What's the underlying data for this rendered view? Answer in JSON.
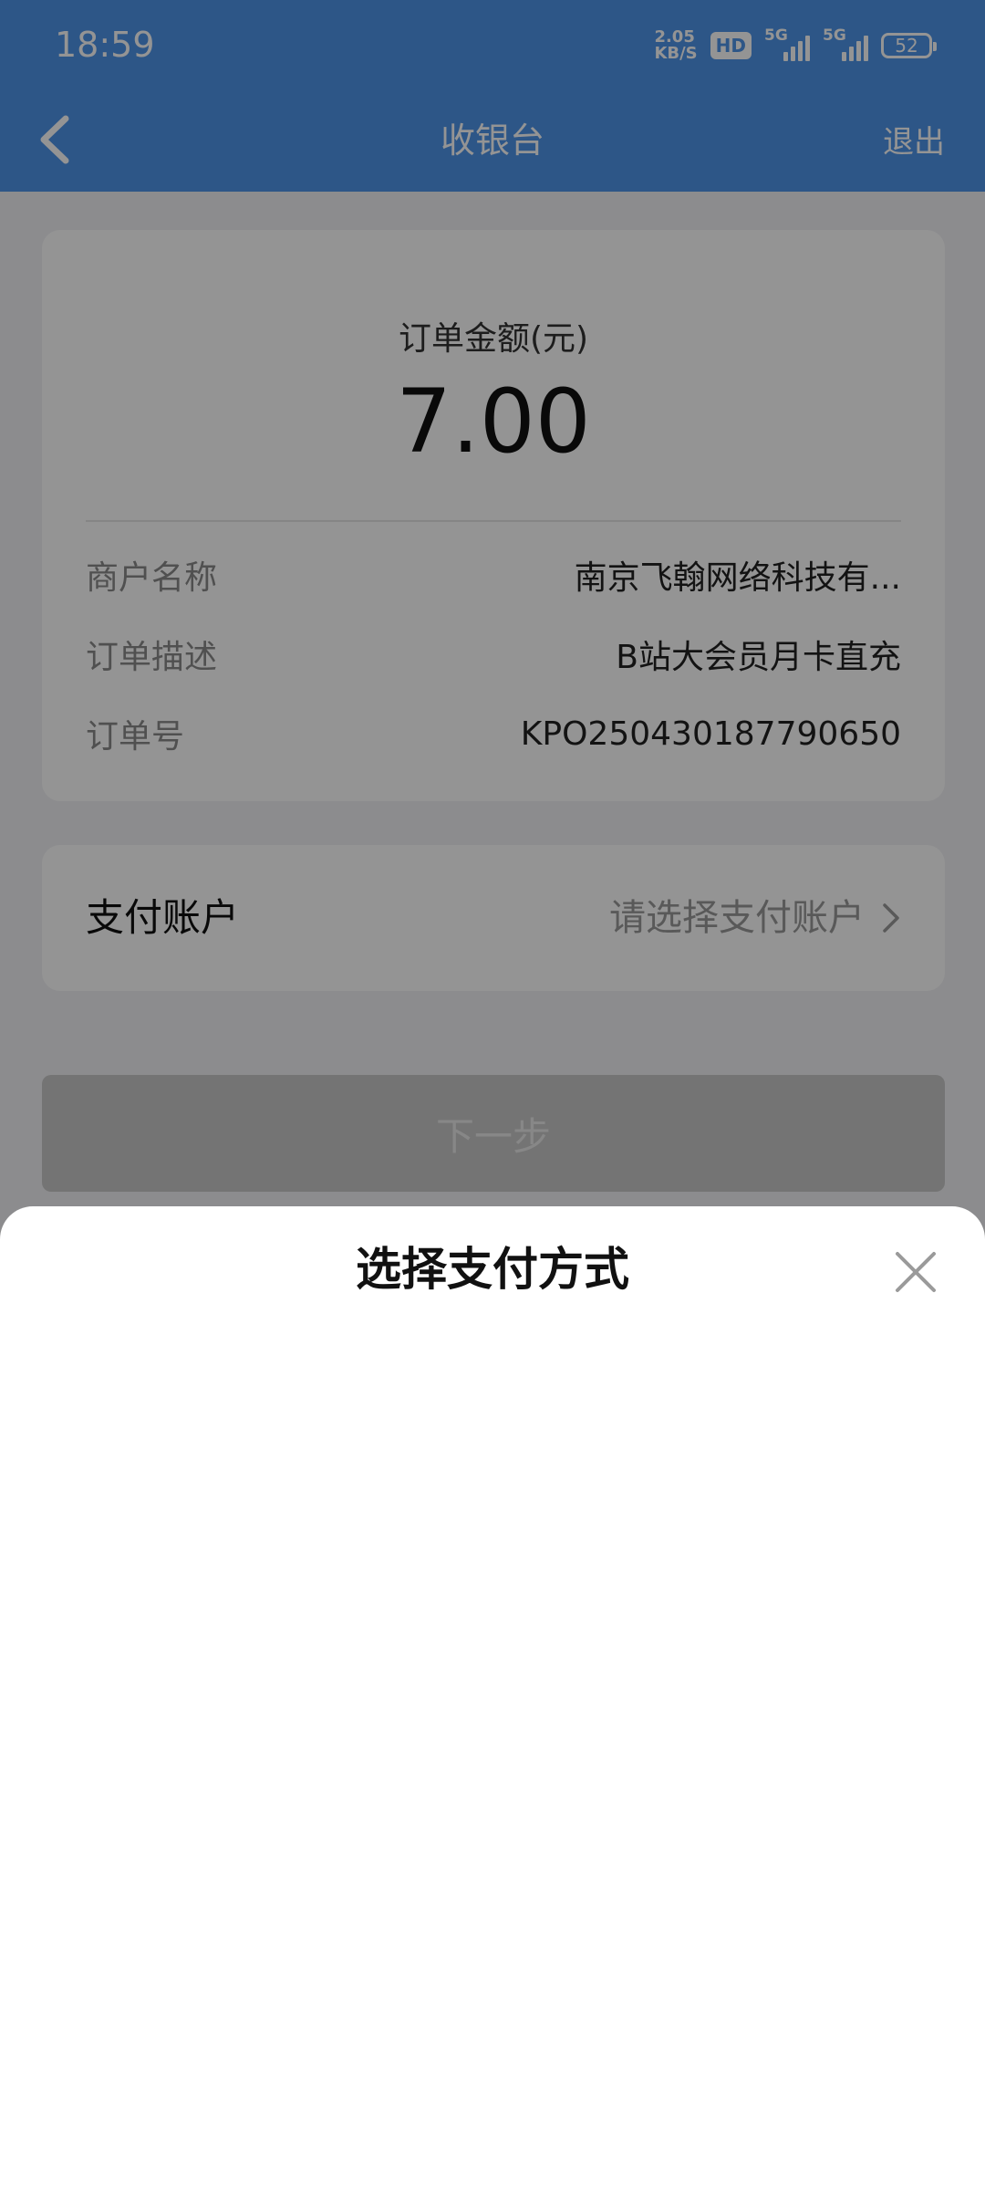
{
  "status_bar": {
    "time": "18:59",
    "net_speed_value": "2.05",
    "net_speed_unit": "KB/S",
    "hd_badge": "HD",
    "signal_1_label": "5G",
    "signal_2_label": "5G",
    "battery": "52"
  },
  "nav": {
    "title": "收银台",
    "exit_label": "退出",
    "back_icon": "chevron-left-icon"
  },
  "order": {
    "amount_label": "订单金额(元)",
    "amount_value": "7.00",
    "rows": [
      {
        "key": "商户名称",
        "value": "南京飞翰网络科技有..."
      },
      {
        "key": "订单描述",
        "value": "B站大会员月卡直充"
      },
      {
        "key": "订单号",
        "value": "KPO250430187790650"
      }
    ]
  },
  "account": {
    "label": "支付账户",
    "placeholder": "请选择支付账户",
    "chevron_icon": "chevron-right-icon"
  },
  "next_button_label": "下一步",
  "sheet": {
    "title": "选择支付方式",
    "close_icon": "close-icon"
  },
  "colors": {
    "primary": "#4f94e8",
    "overlay": "rgba(0,0,0,0.42)"
  }
}
